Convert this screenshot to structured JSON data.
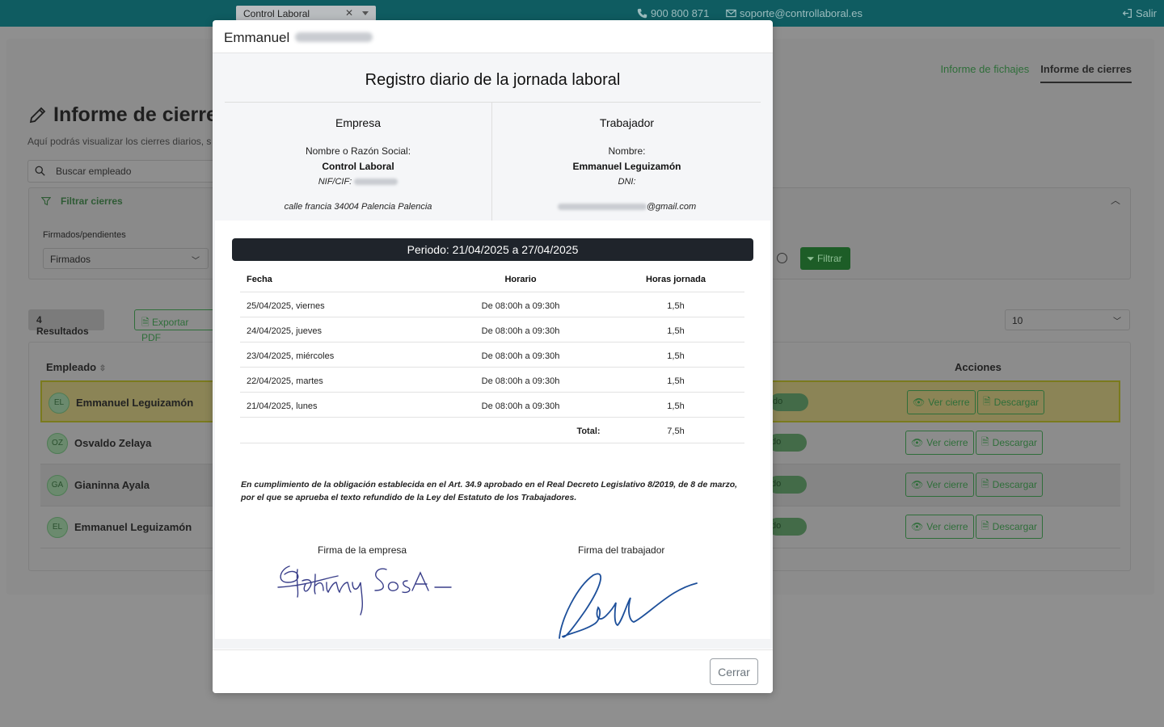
{
  "topbar": {
    "tab_label": "Control Laboral",
    "phone": "900 800 871",
    "email": "soporte@controllaboral.es",
    "logout": "Salir"
  },
  "background": {
    "tabs": [
      "Informe de fichajes",
      "Informe de cierres"
    ],
    "title": "Informe de cierres",
    "subtitle": "Aquí podrás visualizar los cierres diarios, s",
    "search_placeholder": "Buscar empleado",
    "filter_title": "Filtrar cierres",
    "filter_label": "Firmados/pendientes",
    "filter_value": "Firmados",
    "filter_button": "Filtrar",
    "results": "4 Resultados",
    "export": "Exportar PDF",
    "page_size": "10",
    "col_employee": "Empleado",
    "col_actions": "Acciones",
    "view_label": "Ver cierre",
    "download_label": "Descargar",
    "status_fragment": "do",
    "rows": [
      {
        "initials": "EL",
        "name": "Emmanuel Leguizamón"
      },
      {
        "initials": "OZ",
        "name": "Osvaldo Zelaya"
      },
      {
        "initials": "GA",
        "name": "Gianinna Ayala"
      },
      {
        "initials": "EL",
        "name": "Emmanuel Leguizamón"
      }
    ]
  },
  "modal": {
    "header_name": "Emmanuel",
    "doc_title": "Registro diario de la jornada laboral",
    "company": {
      "heading": "Empresa",
      "name_label": "Nombre o Razón Social:",
      "name": "Control Laboral",
      "nif_label": "NIF/CIF:",
      "address": "calle francia 34004 Palencia Palencia"
    },
    "worker": {
      "heading": "Trabajador",
      "name_label": "Nombre:",
      "name": "Emmanuel Leguizamón",
      "dni_label": "DNI:",
      "email_suffix": "@gmail.com"
    },
    "period": "Periodo: 21/04/2025 a 27/04/2025",
    "table_headers": [
      "Fecha",
      "Horario",
      "Horas jornada"
    ],
    "table_rows": [
      {
        "date": "25/04/2025, viernes",
        "schedule": "De 08:00h a 09:30h",
        "hours": "1,5h"
      },
      {
        "date": "24/04/2025, jueves",
        "schedule": "De 08:00h a 09:30h",
        "hours": "1,5h"
      },
      {
        "date": "23/04/2025, miércoles",
        "schedule": "De 08:00h a 09:30h",
        "hours": "1,5h"
      },
      {
        "date": "22/04/2025, martes",
        "schedule": "De 08:00h a 09:30h",
        "hours": "1,5h"
      },
      {
        "date": "21/04/2025, lunes",
        "schedule": "De 08:00h a 09:30h",
        "hours": "1,5h"
      }
    ],
    "total_label": "Total:",
    "total_value": "7,5h",
    "legal_text": "En cumplimiento de la obligación establecida en el Art. 34.9 aprobado en el Real Decreto Legislativo 8/2019, de 8 de marzo, por el que se aprueba el texto refundido de la Ley del Estatuto de los Trabajadores.",
    "company_signature_label": "Firma de la empresa",
    "worker_signature_label": "Firma del trabajador",
    "close_button": "Cerrar"
  },
  "colors": {
    "topbar": "#0f5c61",
    "period_bar": "#1f242b",
    "company_signature_ink": "#3a3f8a",
    "worker_signature_ink": "#1d4f9a"
  }
}
